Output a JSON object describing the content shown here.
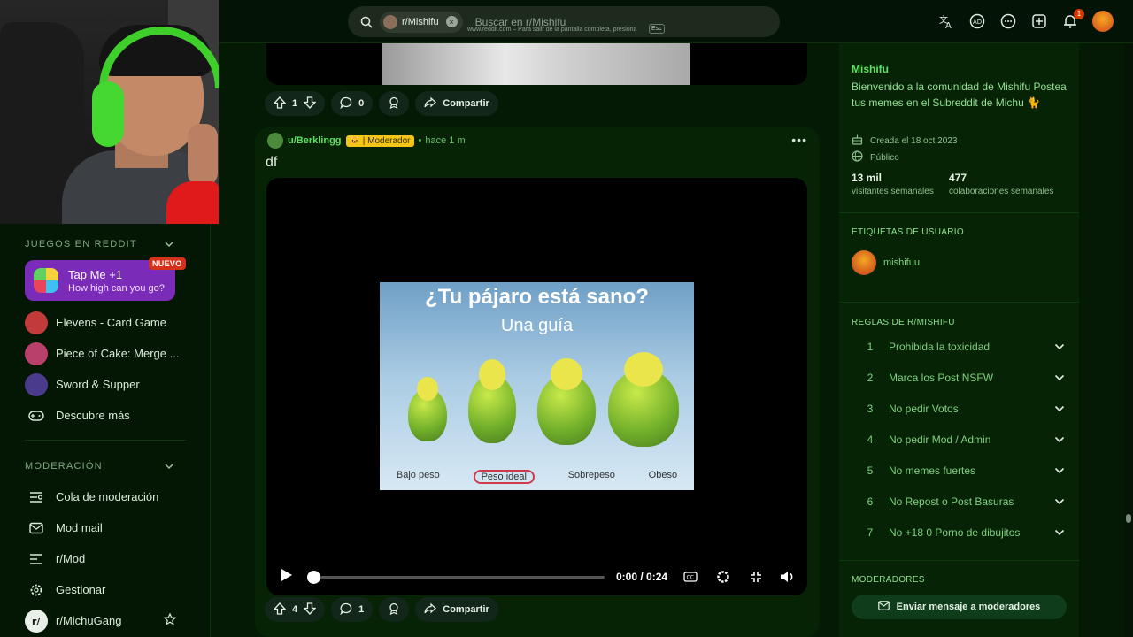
{
  "search": {
    "community_chip": "r/Mishifu",
    "placeholder": "Buscar en r/Mishifu",
    "fullscreen_hint": "www.reddit.com – Para salir de la pantalla completa, presiona",
    "esc_key": "Esc"
  },
  "topbar": {
    "notifications_count": "1"
  },
  "sidebar": {
    "games_header": "JUEGOS EN REDDIT",
    "featured": {
      "title": "Tap Me +1",
      "subtitle": "How high can you go?",
      "badge": "NUEVO"
    },
    "games": [
      {
        "label": "Elevens - Card Game"
      },
      {
        "label": "Piece of Cake: Merge ..."
      },
      {
        "label": "Sword & Supper"
      },
      {
        "label": "Descubre más"
      }
    ],
    "mod_header": "MODERACIÓN",
    "mod_items": [
      {
        "label": "Cola de moderación"
      },
      {
        "label": "Mod mail"
      },
      {
        "label": "r/Mod"
      },
      {
        "label": "Gestionar"
      },
      {
        "label": "r/MichuGang"
      }
    ]
  },
  "prev_post": {
    "upvotes": "1",
    "comments": "0",
    "share": "Compartir"
  },
  "post": {
    "user": "u/Berklingg",
    "flair": "| Moderador",
    "time": "hace 1 m",
    "title": "df",
    "image": {
      "heading": "¿Tu pájaro está sano?",
      "subheading": "Una guía",
      "labels": [
        "Bajo peso",
        "Peso ideal",
        "Sobrepeso",
        "Obeso"
      ]
    },
    "video_time": "0:00 / 0:24",
    "video_progress": 0,
    "upvotes": "4",
    "comments": "1",
    "share": "Compartir"
  },
  "community": {
    "name": "Mishifu",
    "description": "Bienvenido a la comunidad de Mishifu Postea tus memes en el Subreddit de Michu 🐈",
    "created": "Creada el 18 oct 2023",
    "visibility": "Público",
    "stats": [
      {
        "value": "13 mil",
        "label": "visitantes semanales"
      },
      {
        "value": "477",
        "label": "colaboraciones semanales"
      }
    ],
    "user_flair_header": "ETIQUETAS DE USUARIO",
    "user_flair": "mishifuu",
    "rules_header": "REGLAS DE R/MISHIFU",
    "rules": [
      {
        "n": "1",
        "text": "Prohibida la toxicidad"
      },
      {
        "n": "2",
        "text": "Marca los Post NSFW"
      },
      {
        "n": "3",
        "text": "No pedir Votos"
      },
      {
        "n": "4",
        "text": "No pedir Mod / Admin"
      },
      {
        "n": "5",
        "text": "No memes fuertes"
      },
      {
        "n": "6",
        "text": "No Repost o Post Basuras"
      },
      {
        "n": "7",
        "text": "No +18 0 Porno de dibujitos"
      }
    ],
    "mods_header": "MODERADORES",
    "message_mods": "Enviar mensaje a moderadores"
  },
  "colors": {
    "accent": "#5fe25f",
    "background": "#041a04",
    "flair": "#f5c518"
  }
}
